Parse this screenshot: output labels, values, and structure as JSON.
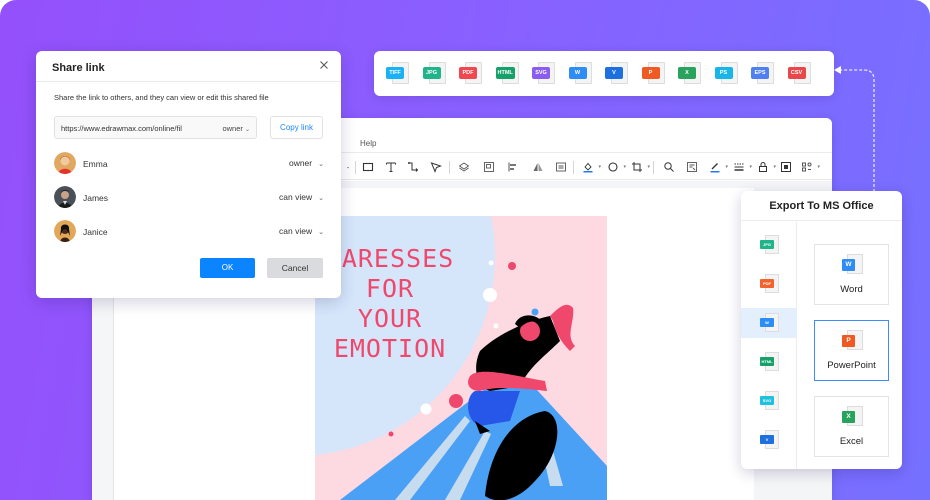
{
  "colors": {
    "accent_blue": "#0a84ff",
    "link_blue": "#1e88ff",
    "bg_gradient_start": "#9450fb",
    "bg_gradient_end": "#7670ff",
    "poster_pink": "#fdd9e1",
    "poster_blue": "#d5e6fb",
    "poster_text": "#f0486c"
  },
  "editor": {
    "menu": {
      "help": "Help"
    },
    "toolbar": [
      {
        "icon": "rectangle-icon"
      },
      {
        "icon": "text-icon"
      },
      {
        "icon": "connector-icon"
      },
      {
        "icon": "pointer-icon"
      },
      {
        "icon": "layers-icon"
      },
      {
        "icon": "group-icon"
      },
      {
        "icon": "align-icon"
      },
      {
        "icon": "flip-icon"
      },
      {
        "icon": "size-icon"
      },
      {
        "icon": "fill-icon"
      },
      {
        "icon": "shape-style-icon"
      },
      {
        "icon": "crop-icon"
      },
      {
        "icon": "search-icon"
      },
      {
        "icon": "format-painter-icon"
      },
      {
        "icon": "line-color-icon"
      },
      {
        "icon": "line-style-icon"
      },
      {
        "icon": "lock-icon"
      },
      {
        "icon": "focus-icon"
      },
      {
        "icon": "more-icon"
      }
    ]
  },
  "poster": {
    "title_lines": [
      "CARESSES",
      "FOR",
      "YOUR",
      "EMOTION"
    ]
  },
  "share": {
    "title": "Share link",
    "close_icon": "close-icon",
    "description": "Share the link to others, and they can view or edit this shared file",
    "link_url": "https://www.edrawmax.com/online/fil",
    "link_permission": "owner",
    "copy_label": "Copy link",
    "users": [
      {
        "name": "Emma",
        "role": "owner"
      },
      {
        "name": "James",
        "role": "can view"
      },
      {
        "name": "Janice",
        "role": "can view"
      }
    ],
    "ok_label": "OK",
    "cancel_label": "Cancel"
  },
  "formats": [
    {
      "label": "TIFF",
      "color": "#1ab1f5"
    },
    {
      "label": "JPG",
      "color": "#1fb48a"
    },
    {
      "label": "PDF",
      "color": "#f2474f"
    },
    {
      "label": "HTML",
      "color": "#16a06a"
    },
    {
      "label": "SVG",
      "color": "#8a5df0"
    },
    {
      "label": "W",
      "color": "#2d8cf6"
    },
    {
      "label": "V",
      "color": "#1e6fe0"
    },
    {
      "label": "P",
      "color": "#f05a22"
    },
    {
      "label": "X",
      "color": "#27a35e"
    },
    {
      "label": "PS",
      "color": "#18b6e8"
    },
    {
      "label": "EPS",
      "color": "#4f7ff0"
    },
    {
      "label": "CSV",
      "color": "#e9484b"
    }
  ],
  "export": {
    "title": "Export To MS Office",
    "side_items": [
      {
        "label": "JPG",
        "color": "#1fb48a",
        "active": false
      },
      {
        "label": "PDF",
        "color": "#f2632e",
        "active": false
      },
      {
        "label": "W",
        "color": "#2d8cf6",
        "active": true
      },
      {
        "label": "HTML",
        "color": "#16a06a",
        "active": false
      },
      {
        "label": "SVG",
        "color": "#1ec1e0",
        "active": false
      },
      {
        "label": "V",
        "color": "#1e6fe0",
        "active": false
      }
    ],
    "cards": [
      {
        "label": "Word",
        "badge": "W",
        "color": "#2d8cf6",
        "active": false
      },
      {
        "label": "PowerPoint",
        "badge": "P",
        "color": "#f05a22",
        "active": true
      },
      {
        "label": "Excel",
        "badge": "X",
        "color": "#27a35e",
        "active": false
      }
    ]
  }
}
